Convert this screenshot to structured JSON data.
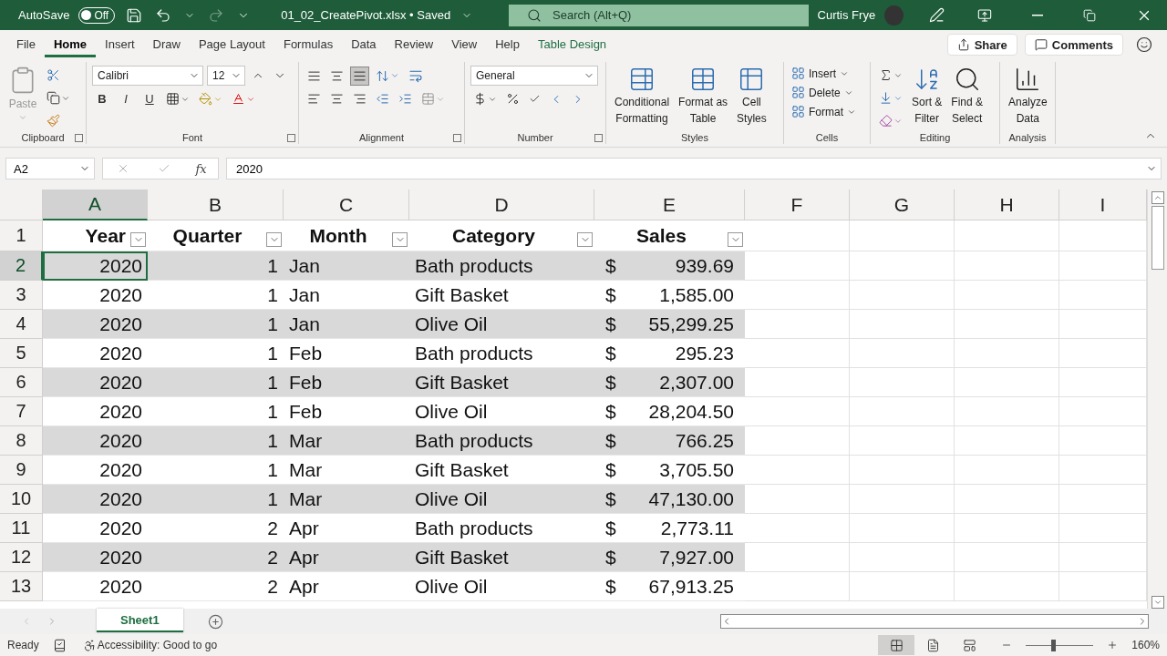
{
  "title_bar": {
    "autosave_label": "AutoSave",
    "autosave": {
      "on": false,
      "label": "Off"
    },
    "file_title": "01_02_CreatePivot.xlsx • Saved",
    "search_placeholder": "Search (Alt+Q)",
    "user_name": "Curtis Frye"
  },
  "menu_tabs": [
    {
      "label": "File",
      "selected": false
    },
    {
      "label": "Home",
      "selected": true
    },
    {
      "label": "Insert",
      "selected": false
    },
    {
      "label": "Draw",
      "selected": false
    },
    {
      "label": "Page Layout",
      "selected": false
    },
    {
      "label": "Formulas",
      "selected": false
    },
    {
      "label": "Data",
      "selected": false
    },
    {
      "label": "Review",
      "selected": false
    },
    {
      "label": "View",
      "selected": false
    },
    {
      "label": "Help",
      "selected": false
    },
    {
      "label": "Table Design",
      "selected": false
    }
  ],
  "share": "Share",
  "comments": "Comments",
  "ribbon": {
    "clipboard": {
      "paste": "Paste",
      "label": "Clipboard"
    },
    "font": {
      "font_name": "Calibri",
      "font_size": "12",
      "bold": "B",
      "italic": "I",
      "underline": "U",
      "label": "Font"
    },
    "alignment": {
      "bottom_align_selected": true,
      "label": "Alignment"
    },
    "number": {
      "format": "General",
      "label": "Number"
    },
    "styles": {
      "buttons": [
        {
          "lines": [
            "Conditional",
            "Formatting"
          ]
        },
        {
          "lines": [
            "Format as",
            "Table"
          ]
        },
        {
          "lines": [
            "Cell",
            "Styles"
          ]
        }
      ],
      "label": "Styles"
    },
    "cells": {
      "buttons": [
        "Insert",
        "Delete",
        "Format"
      ],
      "label": "Cells"
    },
    "editing": {
      "buttons": [
        {
          "lines": [
            "Sort &",
            "Filter"
          ]
        },
        {
          "lines": [
            "Find &",
            "Select"
          ]
        }
      ],
      "label": "Editing"
    },
    "analysis": {
      "button": [
        "Analyze",
        "Data"
      ],
      "label": "Analysis"
    }
  },
  "formula_bar": {
    "name_box": "A2",
    "fx": "fx",
    "value": "2020"
  },
  "columns": [
    {
      "letter": "A",
      "selected": true
    },
    {
      "letter": "B",
      "selected": false
    },
    {
      "letter": "C",
      "selected": false
    },
    {
      "letter": "D",
      "selected": false
    },
    {
      "letter": "E",
      "selected": false
    },
    {
      "letter": "F",
      "selected": false
    },
    {
      "letter": "G",
      "selected": false
    },
    {
      "letter": "H",
      "selected": false
    },
    {
      "letter": "I",
      "selected": false
    }
  ],
  "header_row": {
    "number": "1",
    "cells": [
      "Year",
      "Quarter",
      "Month",
      "Category",
      "Sales"
    ]
  },
  "rows": [
    {
      "number": "2",
      "selected": true,
      "year": "2020",
      "quarter": "1",
      "month": "Jan",
      "category": "Bath products",
      "currency": "$",
      "sales": "939.69"
    },
    {
      "number": "3",
      "selected": false,
      "year": "2020",
      "quarter": "1",
      "month": "Jan",
      "category": "Gift Basket",
      "currency": "$",
      "sales": "1,585.00"
    },
    {
      "number": "4",
      "selected": false,
      "year": "2020",
      "quarter": "1",
      "month": "Jan",
      "category": "Olive Oil",
      "currency": "$",
      "sales": "55,299.25"
    },
    {
      "number": "5",
      "selected": false,
      "year": "2020",
      "quarter": "1",
      "month": "Feb",
      "category": "Bath products",
      "currency": "$",
      "sales": "295.23"
    },
    {
      "number": "6",
      "selected": false,
      "year": "2020",
      "quarter": "1",
      "month": "Feb",
      "category": "Gift Basket",
      "currency": "$",
      "sales": "2,307.00"
    },
    {
      "number": "7",
      "selected": false,
      "year": "2020",
      "quarter": "1",
      "month": "Feb",
      "category": "Olive Oil",
      "currency": "$",
      "sales": "28,204.50"
    },
    {
      "number": "8",
      "selected": false,
      "year": "2020",
      "quarter": "1",
      "month": "Mar",
      "category": "Bath products",
      "currency": "$",
      "sales": "766.25"
    },
    {
      "number": "9",
      "selected": false,
      "year": "2020",
      "quarter": "1",
      "month": "Mar",
      "category": "Gift Basket",
      "currency": "$",
      "sales": "3,705.50"
    },
    {
      "number": "10",
      "selected": false,
      "year": "2020",
      "quarter": "1",
      "month": "Mar",
      "category": "Olive Oil",
      "currency": "$",
      "sales": "47,130.00"
    },
    {
      "number": "11",
      "selected": false,
      "year": "2020",
      "quarter": "2",
      "month": "Apr",
      "category": "Bath products",
      "currency": "$",
      "sales": "2,773.11"
    },
    {
      "number": "12",
      "selected": false,
      "year": "2020",
      "quarter": "2",
      "month": "Apr",
      "category": "Gift Basket",
      "currency": "$",
      "sales": "7,927.00"
    },
    {
      "number": "13",
      "selected": false,
      "year": "2020",
      "quarter": "2",
      "month": "Apr",
      "category": "Olive Oil",
      "currency": "$",
      "sales": "67,913.25"
    }
  ],
  "sheet_tabs": [
    {
      "label": "Sheet1",
      "selected": true
    }
  ],
  "status_bar": {
    "ready": "Ready",
    "accessibility": "Accessibility: Good to go",
    "views": [
      {
        "kind": "normal",
        "selected": true
      },
      {
        "kind": "page_layout",
        "selected": false
      },
      {
        "kind": "page_break",
        "selected": false
      }
    ],
    "zoom": {
      "level": 0.4,
      "label": "160%"
    }
  }
}
